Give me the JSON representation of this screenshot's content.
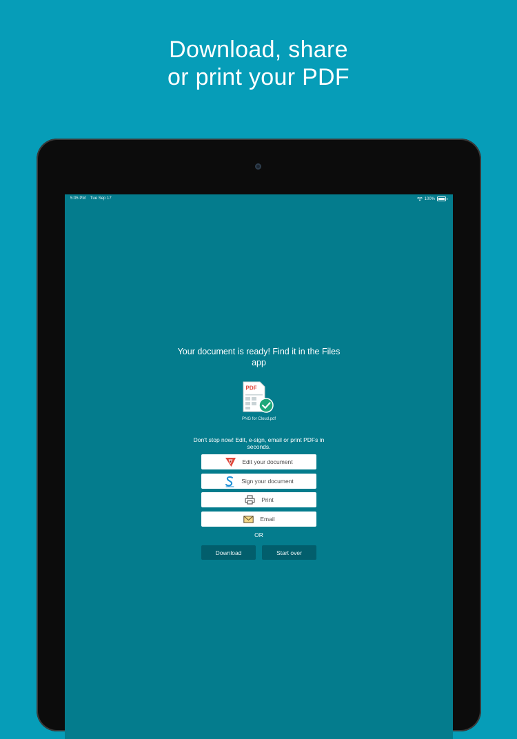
{
  "headline": {
    "line1": "Download, share",
    "line2": "or print your PDF"
  },
  "status_bar": {
    "time": "5:05 PM",
    "date": "Tue Sep 17",
    "battery": "100%"
  },
  "main": {
    "ready_message": "Your document is ready! Find it in the Files app",
    "file_badge": "PDF",
    "file_name": "PNG for Cloud.pdf",
    "promo_text": "Don't stop now! Edit, e-sign, email or print PDFs in seconds.",
    "actions": [
      {
        "label": "Edit your document",
        "icon": "edit-app-icon"
      },
      {
        "label": "Sign your document",
        "icon": "sign-app-icon"
      },
      {
        "label": "Print",
        "icon": "printer-icon"
      },
      {
        "label": "Email",
        "icon": "envelope-icon"
      }
    ],
    "or_label": "OR",
    "download_label": "Download",
    "start_over_label": "Start over"
  },
  "colors": {
    "background": "#069db8",
    "screen": "#047c8d",
    "dark_button": "#025e6c",
    "check_green": "#1fa87a",
    "pdf_red": "#e0463a",
    "sign_blue": "#1c8fd6"
  }
}
